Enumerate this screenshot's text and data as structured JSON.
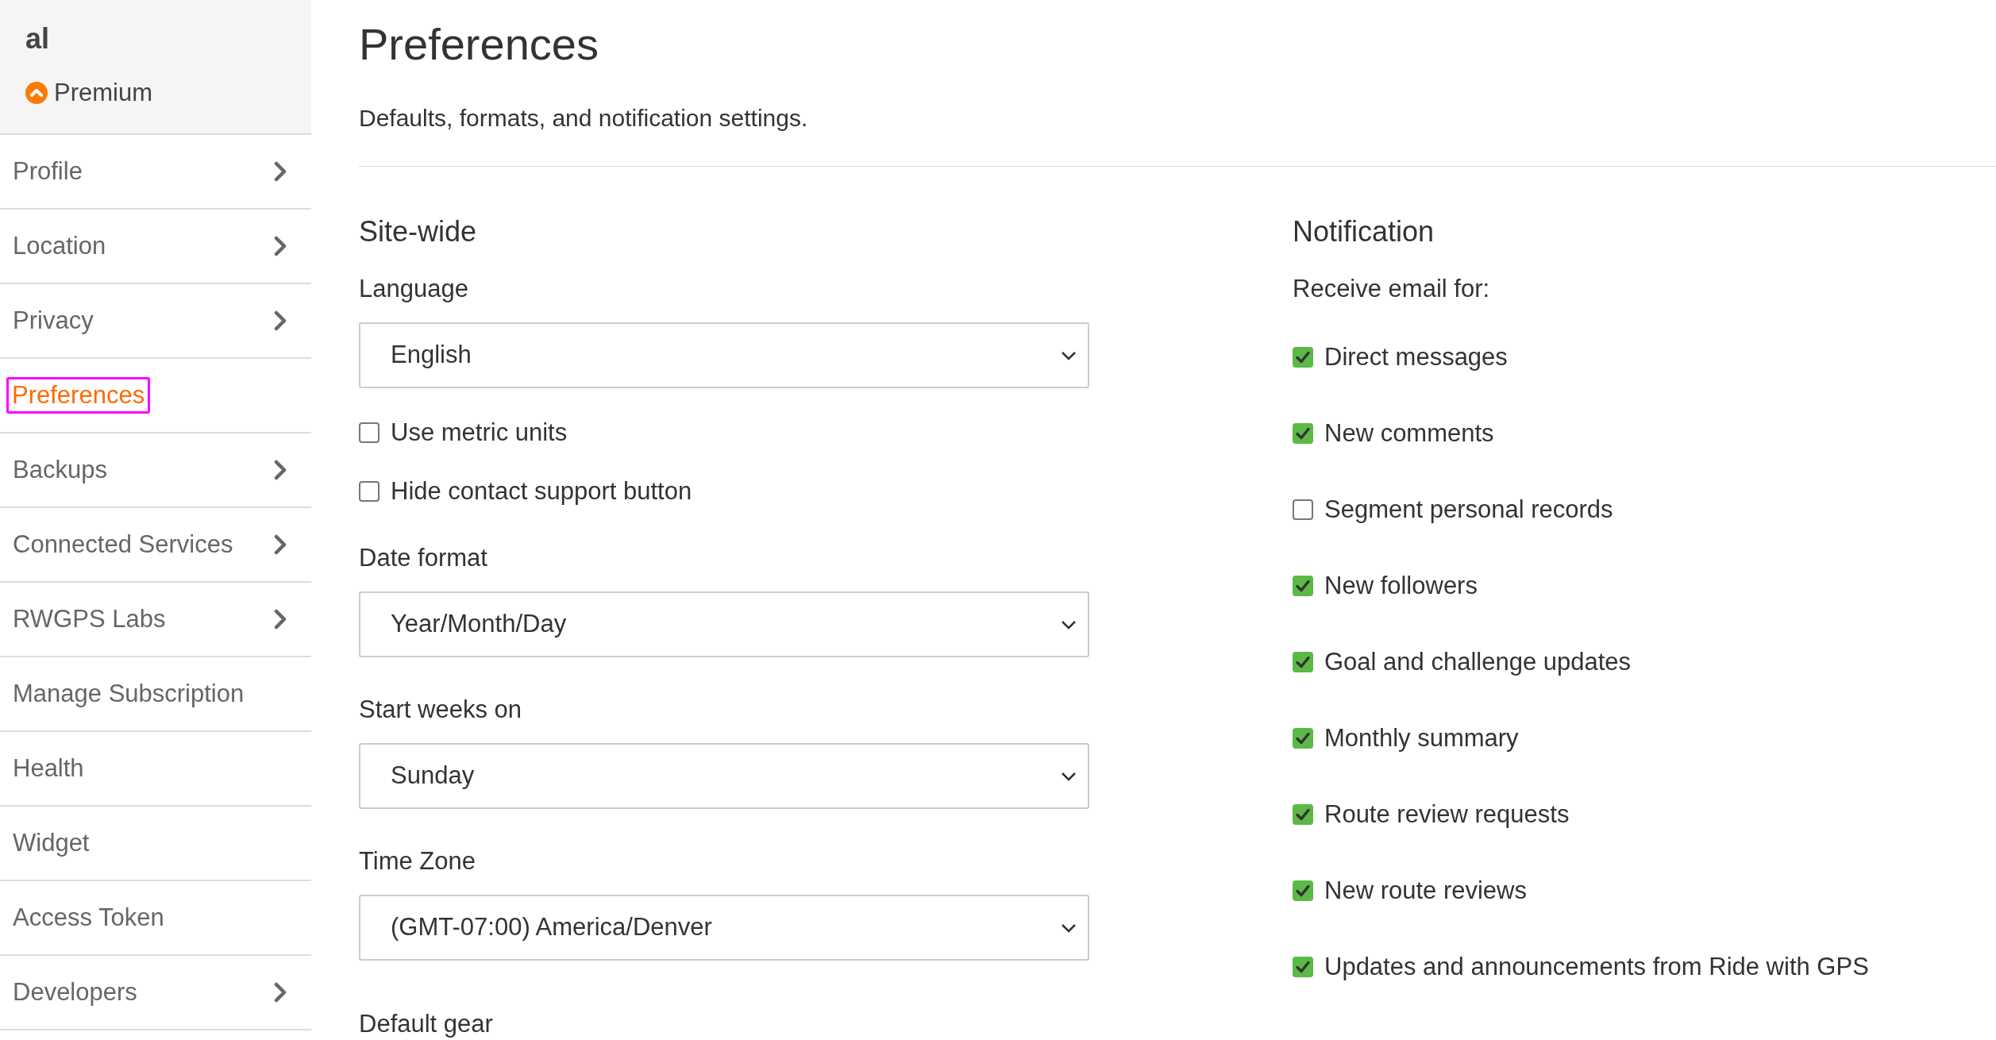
{
  "user": {
    "name": "al",
    "plan": "Premium"
  },
  "sidebar": {
    "items": [
      {
        "label": "Profile",
        "selected": false,
        "has_submenu": true
      },
      {
        "label": "Location",
        "selected": false,
        "has_submenu": true
      },
      {
        "label": "Privacy",
        "selected": false,
        "has_submenu": true
      },
      {
        "label": "Preferences",
        "selected": true,
        "has_submenu": false
      },
      {
        "label": "Backups",
        "selected": false,
        "has_submenu": true
      },
      {
        "label": "Connected Services",
        "selected": false,
        "has_submenu": true
      },
      {
        "label": "RWGPS Labs",
        "selected": false,
        "has_submenu": true
      },
      {
        "label": "Manage Subscription",
        "selected": false,
        "has_submenu": false
      },
      {
        "label": "Health",
        "selected": false,
        "has_submenu": false
      },
      {
        "label": "Widget",
        "selected": false,
        "has_submenu": false
      },
      {
        "label": "Access Token",
        "selected": false,
        "has_submenu": false
      },
      {
        "label": "Developers",
        "selected": false,
        "has_submenu": true
      }
    ]
  },
  "page": {
    "title": "Preferences",
    "subtitle": "Defaults, formats, and notification settings."
  },
  "site_wide": {
    "heading": "Site-wide",
    "fields": [
      {
        "kind": "select",
        "label": "Language",
        "value": "English"
      },
      {
        "kind": "checkbox",
        "label": "Use metric units",
        "checked": false
      },
      {
        "kind": "checkbox",
        "label": "Hide contact support button",
        "checked": false
      },
      {
        "kind": "select",
        "label": "Date format",
        "value": "Year/Month/Day"
      },
      {
        "kind": "select",
        "label": "Start weeks on",
        "value": "Sunday"
      },
      {
        "kind": "select",
        "label": "Time Zone",
        "value": "(GMT-07:00) America/Denver"
      },
      {
        "kind": "label",
        "label": "Default gear"
      }
    ]
  },
  "notification": {
    "heading": "Notification",
    "intro": "Receive email for:",
    "options": [
      {
        "label": "Direct messages",
        "checked": true
      },
      {
        "label": "New comments",
        "checked": true
      },
      {
        "label": "Segment personal records",
        "checked": false
      },
      {
        "label": "New followers",
        "checked": true
      },
      {
        "label": "Goal and challenge updates",
        "checked": true
      },
      {
        "label": "Monthly summary",
        "checked": true
      },
      {
        "label": "Route review requests",
        "checked": true
      },
      {
        "label": "New route reviews",
        "checked": true
      },
      {
        "label": "Updates and announcements from Ride with GPS",
        "checked": true
      }
    ]
  }
}
